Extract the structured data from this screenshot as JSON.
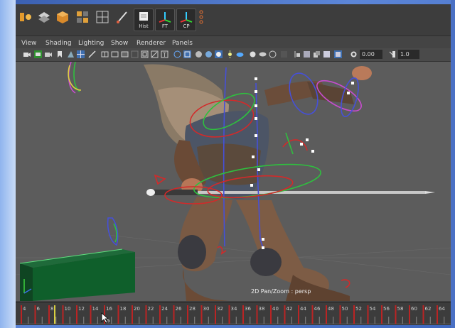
{
  "menu": {
    "view": "View",
    "shading": "Shading",
    "lighting": "Lighting",
    "show": "Show",
    "renderer": "Renderer",
    "panels": "Panels"
  },
  "shelf": {
    "hist": "Hist",
    "ft": "FT",
    "cp": "CP"
  },
  "iconbar": {
    "field_a": "0.00",
    "field_b": "1.0"
  },
  "viewport": {
    "hud_label": "2D Pan/Zoom : persp"
  },
  "timeline": {
    "ticks": [
      "4",
      "6",
      "8",
      "10",
      "12",
      "14",
      "16",
      "18",
      "20",
      "22",
      "24",
      "26",
      "28",
      "30",
      "32",
      "34",
      "36",
      "38",
      "40",
      "42",
      "44",
      "46",
      "48",
      "50",
      "52",
      "54",
      "56",
      "58",
      "60",
      "62",
      "64"
    ],
    "current_frame_marker": "5",
    "key_color": "#d02020",
    "playhead_color": "#d8d040"
  },
  "colors": {
    "maya_bg": "#444444",
    "viewport_bg": "#5c5c5c",
    "desktop_blue": "#4a70c4"
  }
}
